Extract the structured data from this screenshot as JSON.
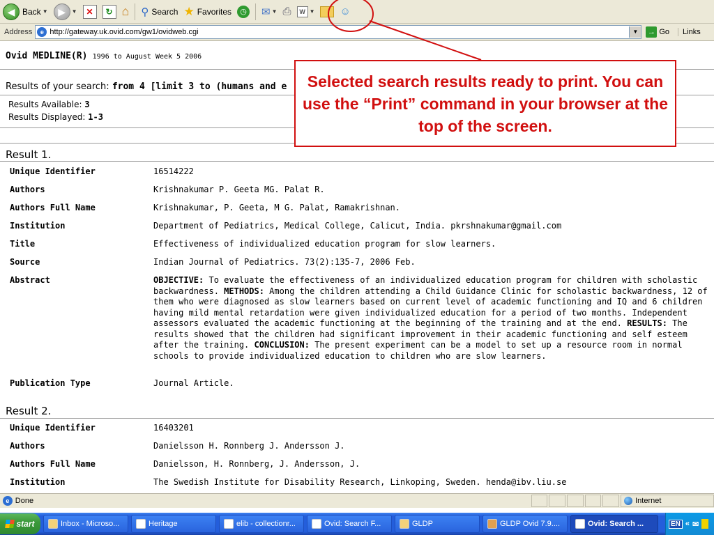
{
  "browser": {
    "toolbar": {
      "back_label": "Back",
      "search_label": "Search",
      "favorites_label": "Favorites"
    },
    "address_label": "Address",
    "url": "http://gateway.uk.ovid.com/gw1/ovidweb.cgi",
    "go_label": "Go",
    "links_label": "Links"
  },
  "page": {
    "db_name": "Ovid MEDLINE(R)",
    "db_range": "1996 to August Week 5 2006",
    "search_prefix": "Results of your search:",
    "search_query": "from 4 [limit 3 to (humans and e",
    "results_available_label": "Results Available:",
    "results_available": "3",
    "results_displayed_label": "Results Displayed:",
    "results_displayed": "1-3"
  },
  "callout": {
    "text": "Selected search results ready to print. You can use the “Print” command in your browser at the top of the screen."
  },
  "results": [
    {
      "heading_word": "Result",
      "heading_num": "1.",
      "fields": {
        "uid_label": "Unique Identifier",
        "uid": "16514222",
        "authors_label": "Authors",
        "authors": "Krishnakumar P. Geeta MG. Palat R.",
        "authors_full_label": "Authors Full Name",
        "authors_full": "Krishnakumar, P. Geeta, M G. Palat, Ramakrishnan.",
        "institution_label": "Institution",
        "institution": "Department of Pediatrics, Medical College, Calicut, India. pkrshnakumar@gmail.com",
        "title_label": "Title",
        "title": "Effectiveness of individualized education program for slow learners.",
        "source_label": "Source",
        "source": "Indian Journal of Pediatrics. 73(2):135-7, 2006 Feb.",
        "abstract_label": "Abstract",
        "abstract_objective_label": "OBJECTIVE:",
        "abstract_objective": " To evaluate the effectiveness of an individualized education program for children with scholastic backwardness. ",
        "abstract_methods_label": "METHODS:",
        "abstract_methods": " Among the children attending a Child Guidance Clinic for scholastic backwardness, 12 of them who were diagnosed as slow learners based on current level of academic functioning and IQ and 6 children having mild mental retardation were given individualized education for a period of two months. Independent assessors evaluated the academic functioning at the beginning of the training and at the end. ",
        "abstract_results_label": "RESULTS:",
        "abstract_results": " The results showed that the children had significant improvement in their academic functioning and self esteem after the training. ",
        "abstract_conclusion_label": "CONCLUSION:",
        "abstract_conclusion": " The present experiment can be a model to set up a resource room in normal schools to provide individualized education to children who are slow learners.",
        "pubtype_label": "Publication Type",
        "pubtype": "Journal Article."
      }
    },
    {
      "heading_word": "Result",
      "heading_num": "2.",
      "fields": {
        "uid_label": "Unique Identifier",
        "uid": "16403201",
        "authors_label": "Authors",
        "authors": "Danielsson H. Ronnberg J. Andersson J.",
        "authors_full_label": "Authors Full Name",
        "authors_full": "Danielsson, H. Ronnberg, J. Andersson, J.",
        "institution_label": "Institution",
        "institution": "The Swedish Institute for Disability Research, Linkoping, Sweden. henda@ibv.liu.se"
      }
    }
  ],
  "statusbar": {
    "status": "Done",
    "zone": "Internet"
  },
  "taskbar": {
    "start": "start",
    "tasks": [
      "Inbox - Microso...",
      "Heritage",
      "elib - collectionr...",
      "Ovid: Search F...",
      "GLDP",
      "GLDP Ovid 7.9....",
      "Ovid: Search ..."
    ],
    "lang": "EN",
    "tray_chevron": "«"
  }
}
